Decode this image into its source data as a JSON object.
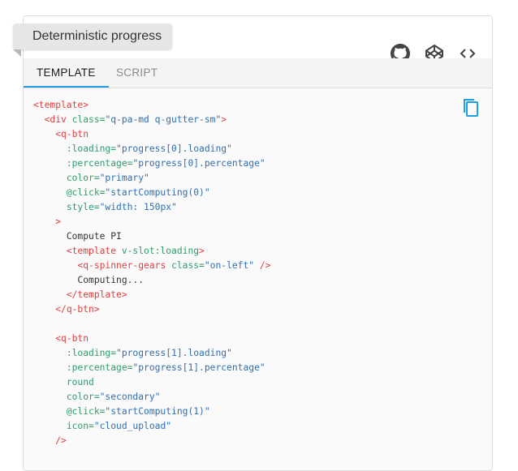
{
  "header": {
    "title": "Deterministic progress",
    "icons": [
      "github-icon",
      "codepen-icon",
      "code-icon"
    ]
  },
  "tabs": [
    {
      "label": "TEMPLATE",
      "active": true
    },
    {
      "label": "SCRIPT",
      "active": false
    }
  ],
  "colors": {
    "accent": "#1ca0e3",
    "tag": "#e03e3e",
    "attr": "#2e9c6b",
    "string": "#2f6fb1"
  },
  "code": [
    {
      "indent": 0,
      "parts": [
        [
          "tag",
          "<template>"
        ]
      ]
    },
    {
      "indent": 2,
      "parts": [
        [
          "tag",
          "<div "
        ],
        [
          "attr",
          "class="
        ],
        [
          "str",
          "\"q-pa-md q-gutter-sm\""
        ],
        [
          "tag",
          ">"
        ]
      ]
    },
    {
      "indent": 4,
      "parts": [
        [
          "tag",
          "<q-btn"
        ]
      ]
    },
    {
      "indent": 6,
      "parts": [
        [
          "attr",
          ":loading="
        ],
        [
          "str",
          "\"progress[0].loading\""
        ]
      ]
    },
    {
      "indent": 6,
      "parts": [
        [
          "attr",
          ":percentage="
        ],
        [
          "str",
          "\"progress[0].percentage\""
        ]
      ]
    },
    {
      "indent": 6,
      "parts": [
        [
          "attr",
          "color="
        ],
        [
          "str",
          "\"primary\""
        ]
      ]
    },
    {
      "indent": 6,
      "parts": [
        [
          "attr",
          "@click="
        ],
        [
          "str",
          "\"startComputing(0)\""
        ]
      ]
    },
    {
      "indent": 6,
      "parts": [
        [
          "attr",
          "style="
        ],
        [
          "str",
          "\"width: 150px\""
        ]
      ]
    },
    {
      "indent": 4,
      "parts": [
        [
          "tag",
          ">"
        ]
      ]
    },
    {
      "indent": 6,
      "parts": [
        [
          "txt",
          "Compute PI"
        ]
      ]
    },
    {
      "indent": 6,
      "parts": [
        [
          "tag",
          "<template "
        ],
        [
          "attr",
          "v-slot:loading"
        ],
        [
          "tag",
          ">"
        ]
      ]
    },
    {
      "indent": 8,
      "parts": [
        [
          "tag",
          "<q-spinner-gears "
        ],
        [
          "attr",
          "class="
        ],
        [
          "str",
          "\"on-left\""
        ],
        [
          "tag",
          " />"
        ]
      ]
    },
    {
      "indent": 8,
      "parts": [
        [
          "txt",
          "Computing..."
        ]
      ]
    },
    {
      "indent": 6,
      "parts": [
        [
          "tag",
          "</template>"
        ]
      ]
    },
    {
      "indent": 4,
      "parts": [
        [
          "tag",
          "</q-btn>"
        ]
      ]
    },
    {
      "indent": 0,
      "parts": []
    },
    {
      "indent": 4,
      "parts": [
        [
          "tag",
          "<q-btn"
        ]
      ]
    },
    {
      "indent": 6,
      "parts": [
        [
          "attr",
          ":loading="
        ],
        [
          "str",
          "\"progress[1].loading\""
        ]
      ]
    },
    {
      "indent": 6,
      "parts": [
        [
          "attr",
          ":percentage="
        ],
        [
          "str",
          "\"progress[1].percentage\""
        ]
      ]
    },
    {
      "indent": 6,
      "parts": [
        [
          "attr",
          "round"
        ]
      ]
    },
    {
      "indent": 6,
      "parts": [
        [
          "attr",
          "color="
        ],
        [
          "str",
          "\"secondary\""
        ]
      ]
    },
    {
      "indent": 6,
      "parts": [
        [
          "attr",
          "@click="
        ],
        [
          "str",
          "\"startComputing(1)\""
        ]
      ]
    },
    {
      "indent": 6,
      "parts": [
        [
          "attr",
          "icon="
        ],
        [
          "str",
          "\"cloud_upload\""
        ]
      ]
    },
    {
      "indent": 4,
      "parts": [
        [
          "tag",
          "/>"
        ]
      ]
    }
  ]
}
